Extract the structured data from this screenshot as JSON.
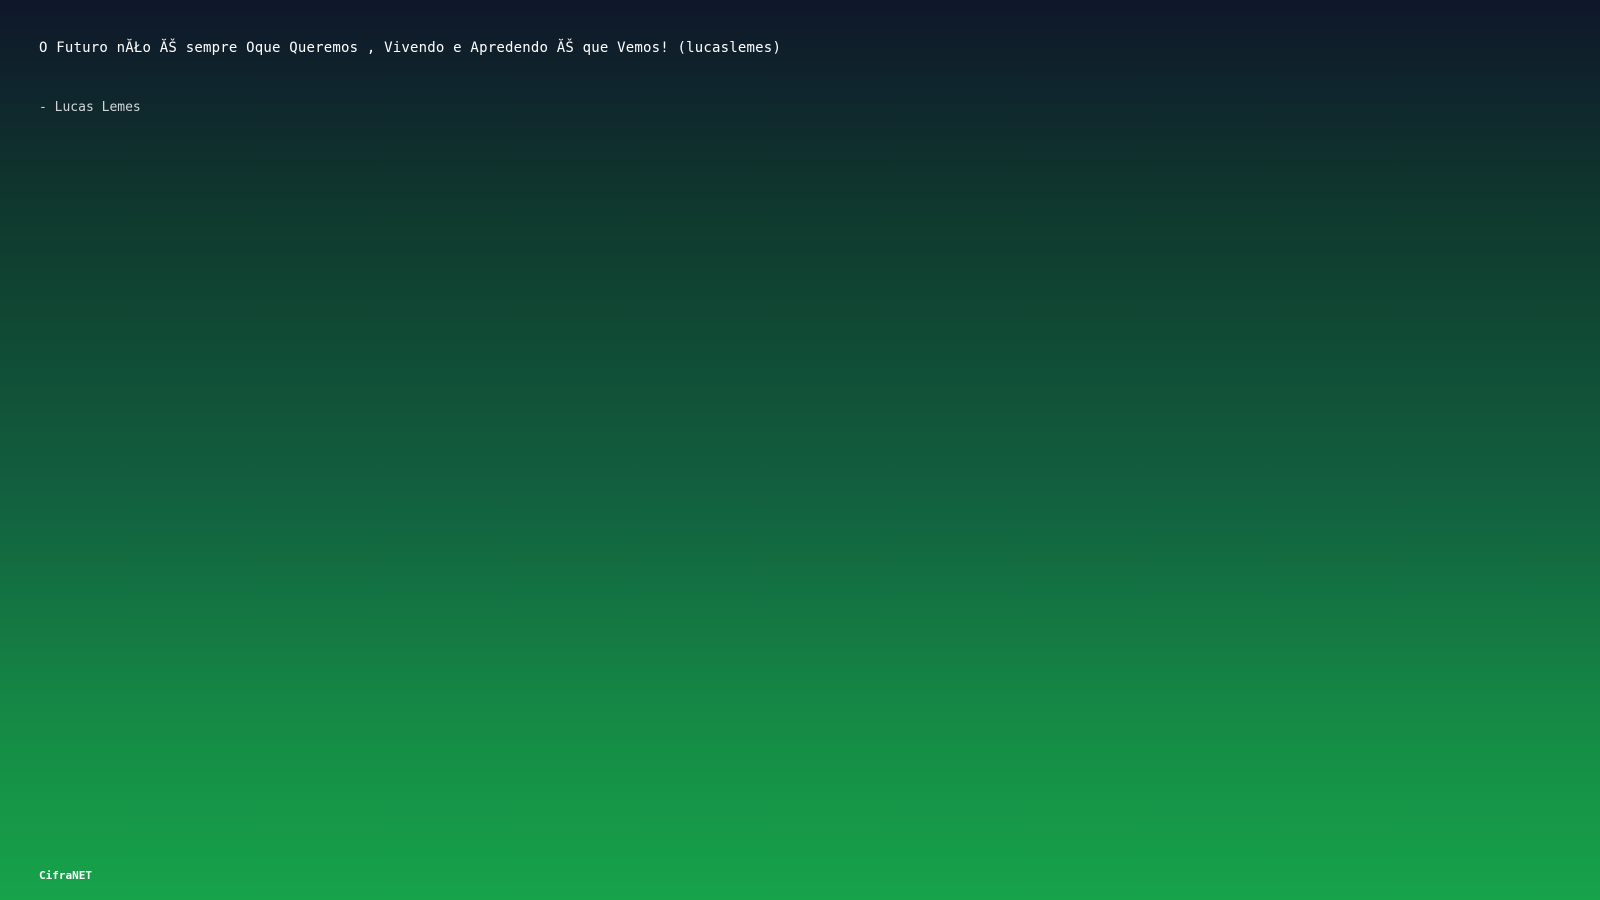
{
  "quote": {
    "text": "O Futuro nĂŁo ĂŠ sempre Oque Queremos , Vivendo e Apredendo ĂŠ que Vemos! (lucaslemes)",
    "author": "- Lucas Lemes"
  },
  "footer": {
    "brand": "CifraNET"
  },
  "colors": {
    "gradient_top": "#0f172a",
    "gradient_bottom": "#16a34a",
    "text": "#ffffff"
  }
}
